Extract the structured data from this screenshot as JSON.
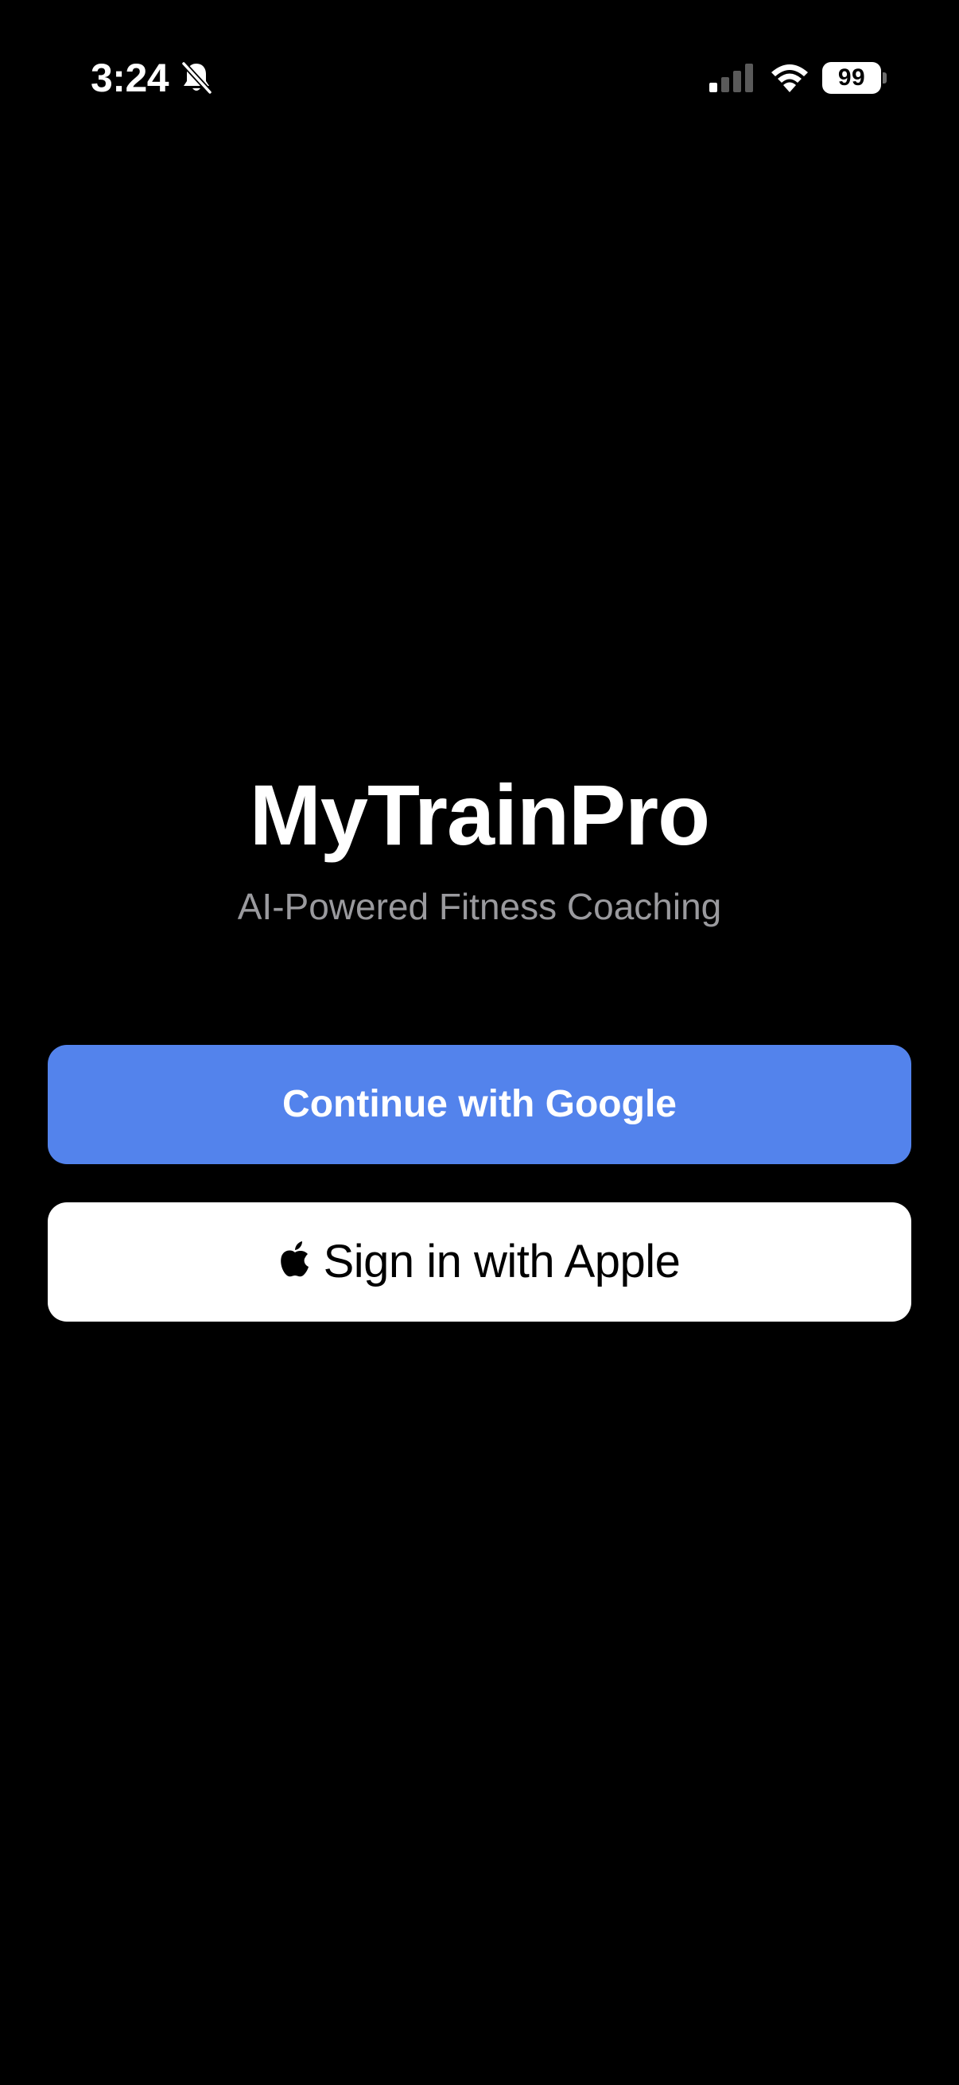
{
  "status_bar": {
    "time": "3:24",
    "battery_level": "99",
    "icons": [
      "bell-slash-icon",
      "cellular-signal-icon",
      "wifi-icon",
      "battery-icon"
    ],
    "signal_bars_active": 1,
    "signal_bars_total": 4
  },
  "brand": {
    "title": "MyTrainPro",
    "subtitle": "AI-Powered Fitness Coaching"
  },
  "auth": {
    "google_label": "Continue with Google",
    "apple_label": "Sign in with Apple",
    "apple_icon": "apple-logo-icon"
  },
  "colors": {
    "background": "#000000",
    "google_button": "#5383ec",
    "apple_button": "#ffffff",
    "subtitle": "#9a9a9e"
  }
}
